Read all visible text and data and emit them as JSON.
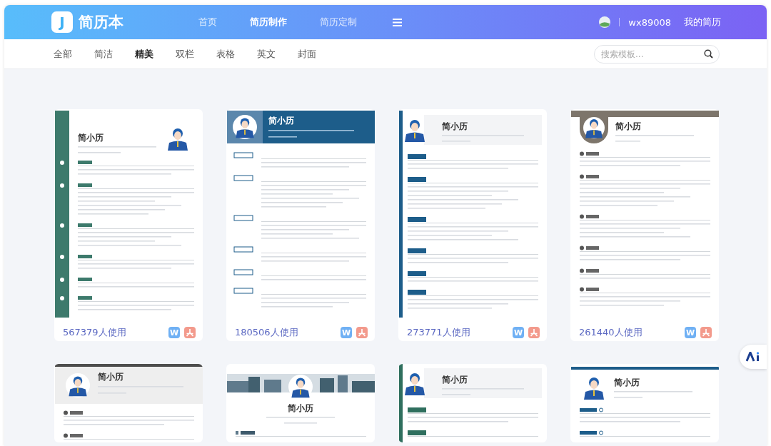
{
  "header": {
    "logo_letter": "J",
    "brand": "简历本",
    "nav": [
      {
        "label": "首页",
        "selected": false
      },
      {
        "label": "简历制作",
        "selected": true
      },
      {
        "label": "简历定制",
        "selected": false
      }
    ],
    "username": "wx89008",
    "my_resumes": "我的简历"
  },
  "categories": [
    {
      "label": "全部",
      "selected": false
    },
    {
      "label": "简洁",
      "selected": false
    },
    {
      "label": "精美",
      "selected": true
    },
    {
      "label": "双栏",
      "selected": false
    },
    {
      "label": "表格",
      "selected": false
    },
    {
      "label": "英文",
      "selected": false
    },
    {
      "label": "封面",
      "selected": false
    }
  ],
  "search": {
    "placeholder": "搜索模板..."
  },
  "templates": [
    {
      "kind": "sidebar",
      "color": "#3d7a6c",
      "name": "简小历",
      "usage": "567379人使用",
      "word_label": "W"
    },
    {
      "kind": "banner",
      "color": "#1d5d8a",
      "name": "简小历",
      "usage": "180506人使用",
      "word_label": "W"
    },
    {
      "kind": "stripe",
      "color": "#1d5d8a",
      "name": "简小历",
      "usage": "273771人使用",
      "word_label": "W"
    },
    {
      "kind": "arch",
      "color": "#7d756b",
      "name": "简小历",
      "usage": "261440人使用",
      "word_label": "W"
    },
    {
      "kind": "greytop",
      "color": "#4d4d4d",
      "name": "简小历"
    },
    {
      "kind": "cityscape",
      "color": "#5f7a8c",
      "name": "简小历"
    },
    {
      "kind": "stripe",
      "color": "#2f6f5e",
      "name": "简小历"
    },
    {
      "kind": "topline",
      "color": "#1d5d8a",
      "name": "简小历"
    }
  ]
}
